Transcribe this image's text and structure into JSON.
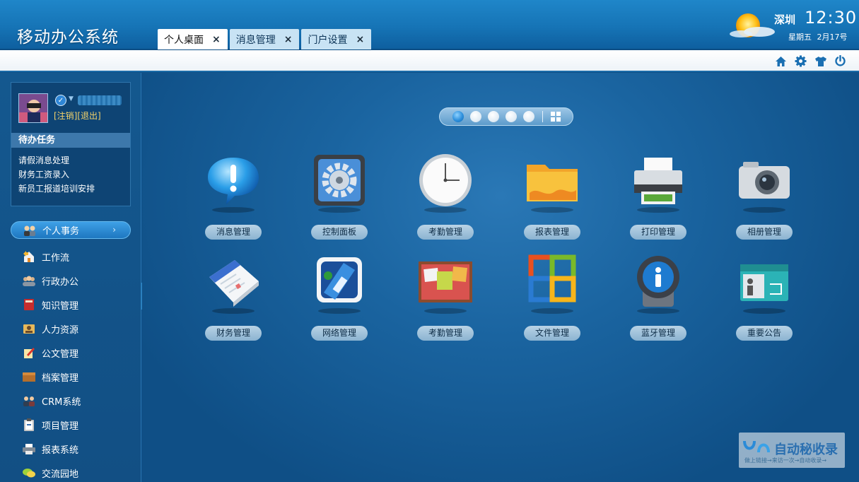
{
  "header": {
    "app_title": "移动办公系统",
    "tabs": [
      {
        "label": "个人桌面",
        "close": "×"
      },
      {
        "label": "消息管理",
        "close": "×"
      },
      {
        "label": "门户设置",
        "close": "×"
      }
    ],
    "weather": {
      "city": "深圳",
      "time": "12:30",
      "date": "星期五 2月17号",
      "icon": "sun-cloud-icon"
    }
  },
  "toolbar": {
    "icons": [
      "home-icon",
      "gear-icon",
      "shirt-icon",
      "power-icon"
    ]
  },
  "sidebar": {
    "profile": {
      "links": "[注销][退出]"
    },
    "todo": {
      "title": "待办任务",
      "items": [
        "请假消息处理",
        "财务工资录入",
        "新员工报道培训安排"
      ]
    },
    "menu": [
      {
        "label": "个人事务",
        "icon": "people-icon",
        "chevron": "›"
      },
      {
        "label": "工作流",
        "icon": "house-arrow-icon"
      },
      {
        "label": "行政办公",
        "icon": "group-icon"
      },
      {
        "label": "知识管理",
        "icon": "book-icon"
      },
      {
        "label": "人力资源",
        "icon": "person-card-icon"
      },
      {
        "label": "公文管理",
        "icon": "document-pen-icon"
      },
      {
        "label": "档案管理",
        "icon": "box-icon"
      },
      {
        "label": "CRM系统",
        "icon": "users-icon"
      },
      {
        "label": "项目管理",
        "icon": "clipboard-icon"
      },
      {
        "label": "报表系统",
        "icon": "printer-report-icon"
      },
      {
        "label": "交流园地",
        "icon": "chat-bubbles-icon"
      }
    ],
    "collapse": "◂"
  },
  "desktop": {
    "apps_row1": [
      {
        "label": "消息管理",
        "icon": "speech-bubble-icon"
      },
      {
        "label": "控制面板",
        "icon": "gear-panel-icon"
      },
      {
        "label": "考勤管理",
        "icon": "clock-icon"
      },
      {
        "label": "报表管理",
        "icon": "folder-icon"
      },
      {
        "label": "打印管理",
        "icon": "printer-icon"
      },
      {
        "label": "相册管理",
        "icon": "camera-icon"
      }
    ],
    "apps_row2": [
      {
        "label": "财务管理",
        "icon": "calendar-icon"
      },
      {
        "label": "网络管理",
        "icon": "network-icon"
      },
      {
        "label": "考勤管理",
        "icon": "notes-board-icon"
      },
      {
        "label": "文件管理",
        "icon": "office-logo-icon"
      },
      {
        "label": "蓝牙管理",
        "icon": "bluetooth-device-icon"
      },
      {
        "label": "重要公告",
        "icon": "announcement-icon"
      }
    ],
    "pager": {
      "pages": 5,
      "active": 1
    }
  },
  "watermark": {
    "text": "自动秘收录",
    "sub": "做上链接→来访一次→自动收录→"
  },
  "colors": {
    "header": "#1674b6",
    "sidebar": "#124f84",
    "main": "#1a64a0",
    "tab_active": "#ffffff",
    "link": "#f5d36a"
  }
}
